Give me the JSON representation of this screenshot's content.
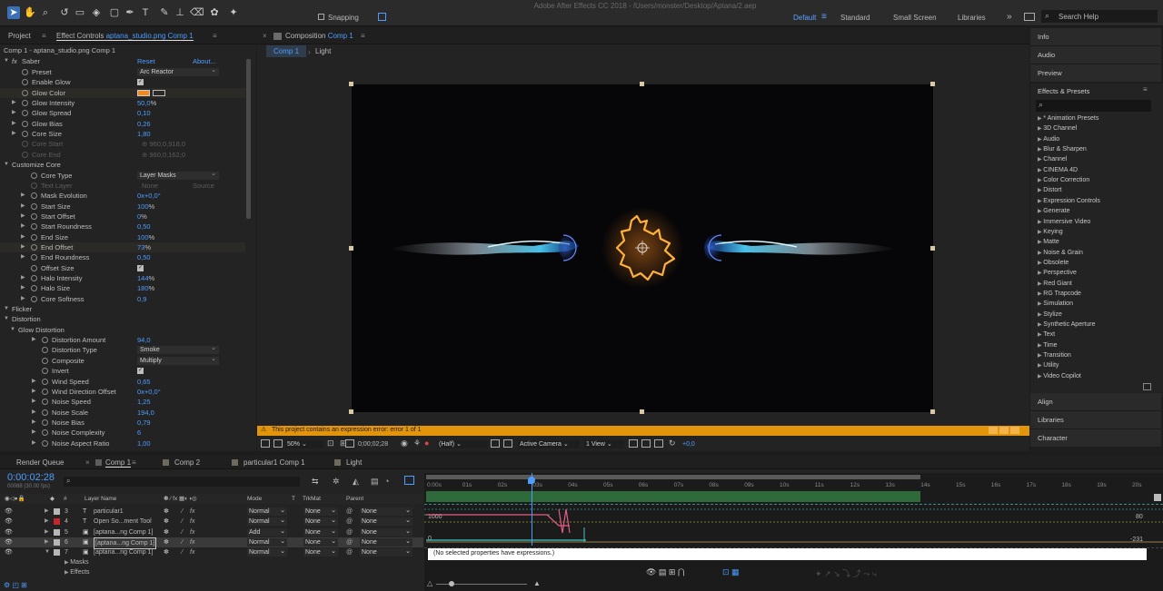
{
  "window_title": "Adobe After Effects CC 2018 - /Users/monster/Desktop/Aptana/2.aep",
  "toolbar": {
    "snapping_label": "Snapping",
    "workspaces": [
      "Default",
      "Standard",
      "Small Screen",
      "Libraries"
    ],
    "active_workspace": "Default",
    "search_help_placeholder": "Search Help"
  },
  "left_panel": {
    "tabs": [
      "Project",
      "Effect Controls",
      "aptana_studio.png Comp 1"
    ],
    "subtitle": "Comp 1 - aptana_studio.png Comp 1",
    "effect_name": "Saber",
    "reset_label": "Reset",
    "about_label": "About...",
    "rows": [
      {
        "label": "Preset",
        "value": "Arc Reactor",
        "kind": "dropdown"
      },
      {
        "label": "Enable Glow",
        "value": "✓",
        "kind": "checkbox"
      },
      {
        "label": "Glow Color",
        "value": "",
        "kind": "color"
      },
      {
        "label": "Glow Intensity",
        "value": "50,0",
        "unit": "%"
      },
      {
        "label": "Glow Spread",
        "value": "0,10"
      },
      {
        "label": "Glow Bias",
        "value": "0,26"
      },
      {
        "label": "Core Size",
        "value": "1,80"
      },
      {
        "label": "Core Start",
        "value": "960,0,918,0",
        "kind": "dim"
      },
      {
        "label": "Core End",
        "value": "960,0,162,0",
        "kind": "dim"
      },
      {
        "label": "Customize Core",
        "kind": "group"
      },
      {
        "label": "Core Type",
        "value": "Layer Masks",
        "kind": "dropdown"
      },
      {
        "label": "Text Layer",
        "value": "None",
        "value2": "Source",
        "kind": "dimdd"
      },
      {
        "label": "Mask Evolution",
        "value": "0x+0,0°"
      },
      {
        "label": "Start Size",
        "value": "100",
        "unit": "%"
      },
      {
        "label": "Start Offset",
        "value": "0",
        "unit": "%"
      },
      {
        "label": "Start Roundness",
        "value": "0,50"
      },
      {
        "label": "End Size",
        "value": "100",
        "unit": "%"
      },
      {
        "label": "End Offset",
        "value": "73",
        "unit": "%"
      },
      {
        "label": "End Roundness",
        "value": "0,50"
      },
      {
        "label": "Offset Size",
        "value": "✓",
        "kind": "checkbox"
      },
      {
        "label": "Halo Intensity",
        "value": "144",
        "unit": "%"
      },
      {
        "label": "Halo Size",
        "value": "180",
        "unit": "%"
      },
      {
        "label": "Core Softness",
        "value": "0,9"
      },
      {
        "label": "Flicker",
        "kind": "group"
      },
      {
        "label": "Distortion",
        "kind": "group"
      },
      {
        "label": "Glow Distortion",
        "kind": "subgroup"
      },
      {
        "label": "Distortion Amount",
        "value": "94,0"
      },
      {
        "label": "Distortion Type",
        "value": "Smoke",
        "kind": "dropdown"
      },
      {
        "label": "Composite",
        "value": "Multiply",
        "kind": "dropdown"
      },
      {
        "label": "Invert",
        "value": "✓",
        "kind": "checkbox"
      },
      {
        "label": "Wind Speed",
        "value": "0,65"
      },
      {
        "label": "Wind Direction Offset",
        "value": "0x+0,0°"
      },
      {
        "label": "Noise Speed",
        "value": "1,25"
      },
      {
        "label": "Noise Scale",
        "value": "194,0"
      },
      {
        "label": "Noise Bias",
        "value": "0,79"
      },
      {
        "label": "Noise Complexity",
        "value": "6"
      },
      {
        "label": "Noise Aspect Ratio",
        "value": "1,00"
      }
    ]
  },
  "composition": {
    "panel_label": "Composition",
    "comp_name": "Comp 1",
    "breadcrumbs": [
      "Comp 1",
      "Light"
    ],
    "warning": "This project contains an expression error: error 1 of 1",
    "zoom": "50%",
    "timecode": "0;00;02;28",
    "resolution": "(Half)",
    "camera": "Active Camera",
    "view": "1 View",
    "exposure": "+0,0"
  },
  "right_panel": {
    "items": [
      "Info",
      "Audio",
      "Preview"
    ],
    "effects_title": "Effects & Presets",
    "search_placeholder": "",
    "categories": [
      "* Animation Presets",
      "3D Channel",
      "Audio",
      "Blur & Sharpen",
      "Channel",
      "CINEMA 4D",
      "Color Correction",
      "Distort",
      "Expression Controls",
      "Generate",
      "Immersive Video",
      "Keying",
      "Matte",
      "Noise & Grain",
      "Obsolete",
      "Perspective",
      "Red Giant",
      "RG Trapcode",
      "Simulation",
      "Stylize",
      "Synthetic Aperture",
      "Text",
      "Time",
      "Transition",
      "Utility",
      "Video Copilot"
    ],
    "bottom_items": [
      "Align",
      "Libraries",
      "Character"
    ]
  },
  "timeline": {
    "tabs": [
      "Render Queue",
      "Comp 1",
      "Comp 2",
      "particular1 Comp 1",
      "Light"
    ],
    "active_tab": "Comp 1",
    "timecode": "0:00:02:28",
    "frame_info": "00088 (30.00 fps)",
    "headers": {
      "layer_name": "Layer Name",
      "mode": "Mode",
      "t": "T",
      "trkmat": "TrkMat",
      "parent": "Parent"
    },
    "layers": [
      {
        "num": "3",
        "color": "#b7b7b7",
        "icon": "T",
        "name": "particular1",
        "mode": "Normal",
        "trkmat": "None",
        "parent": "None"
      },
      {
        "num": "4",
        "color": "#c1272d",
        "icon": "T",
        "name": "Open So...ment Tool",
        "mode": "Normal",
        "trkmat": "None",
        "parent": "None"
      },
      {
        "num": "5",
        "color": "#b7b7b7",
        "icon": "▣",
        "name": "[aptana...ng Comp 1]",
        "mode": "Add",
        "trkmat": "None",
        "parent": "None"
      },
      {
        "num": "6",
        "color": "#b7b7b7",
        "icon": "▣",
        "name": "[aptana...ng Comp 1]",
        "mode": "Normal",
        "trkmat": "None",
        "parent": "None"
      },
      {
        "num": "7",
        "color": "#b7b7b7",
        "icon": "▣",
        "name": "[aptana...ng Comp 1]",
        "mode": "Normal",
        "trkmat": "None",
        "parent": "None"
      }
    ],
    "sub_items": [
      "Masks",
      "Effects"
    ],
    "ruler": [
      "0:00s",
      "01s",
      "02s",
      "03s",
      "04s",
      "05s",
      "06s",
      "07s",
      "08s",
      "09s",
      "10s",
      "11s",
      "12s",
      "13s",
      "14s",
      "15s",
      "16s",
      "17s",
      "18s",
      "19s",
      "20s"
    ],
    "graph_values": {
      "left_top": "1000",
      "left_bottom": "0",
      "right_top": "80",
      "right_bottom": "-231"
    },
    "expression_text": "(No selected properties have expressions.)"
  }
}
